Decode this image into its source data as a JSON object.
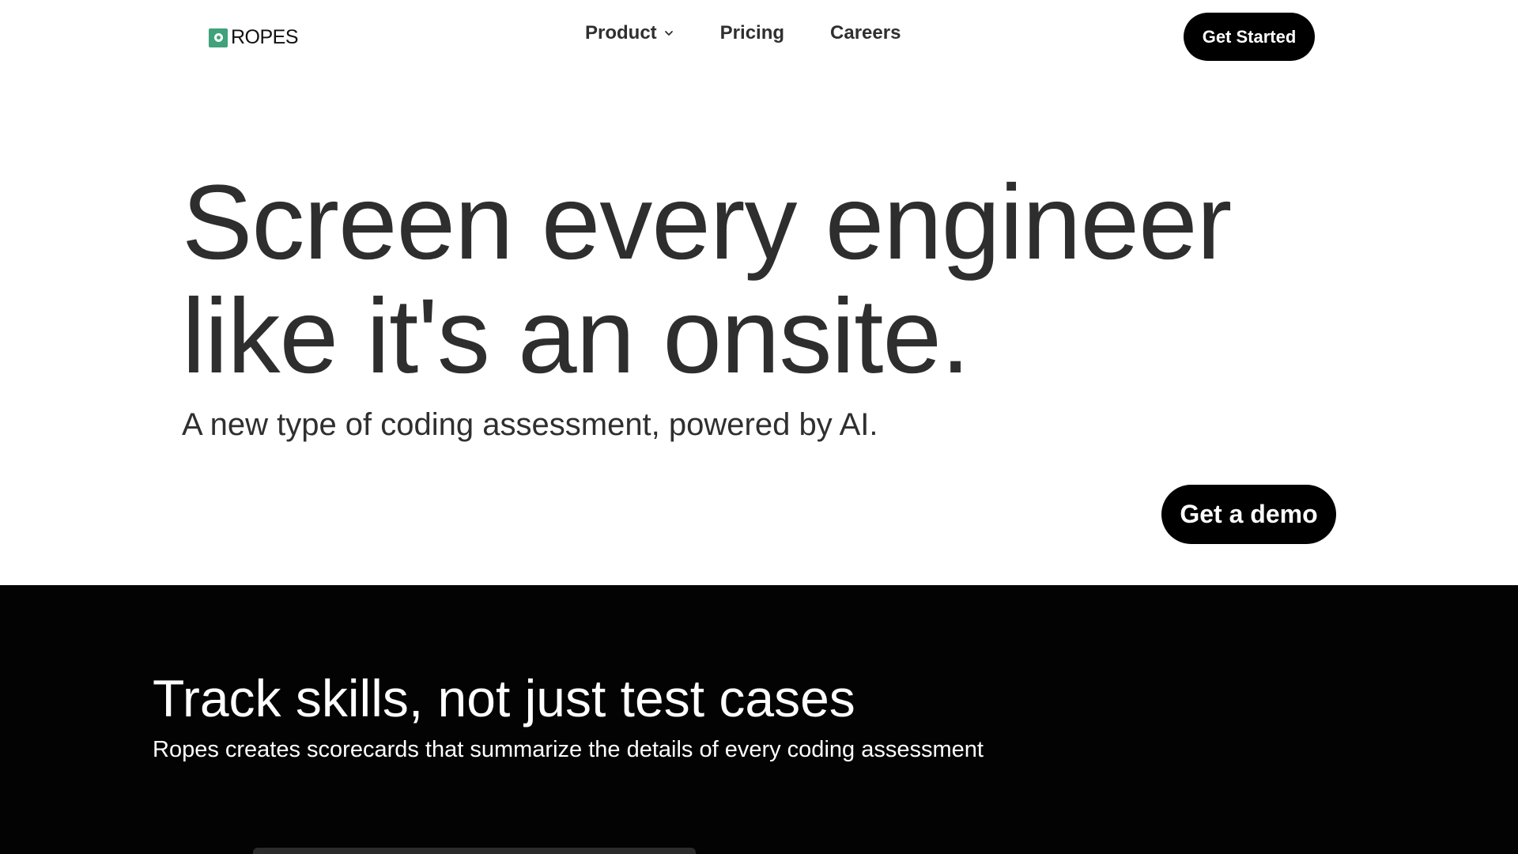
{
  "brand": {
    "name": "ROPES",
    "accent_color": "#3fa27a",
    "logo_icon": "ropes-logo-icon"
  },
  "nav": {
    "items": [
      {
        "label": "Product",
        "has_dropdown": true
      },
      {
        "label": "Pricing"
      },
      {
        "label": "Careers"
      }
    ],
    "cta_label": "Get Started"
  },
  "hero": {
    "title_line1": "Screen every engineer",
    "title_line2": "like it's an onsite.",
    "subtitle": "A new type of coding assessment, powered by AI.",
    "cta_label": "Get a demo"
  },
  "feature": {
    "title": "Track skills, not just test cases",
    "subtitle": "Ropes creates scorecards that summarize the details of every coding assessment"
  }
}
